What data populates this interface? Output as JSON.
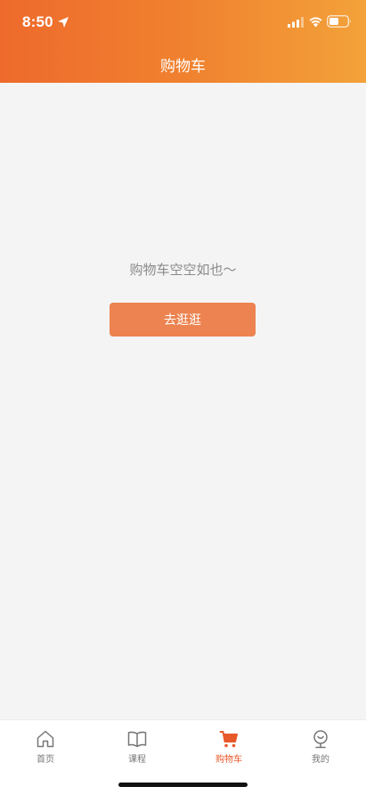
{
  "status_bar": {
    "time": "8:50"
  },
  "nav": {
    "title": "购物车"
  },
  "empty_state": {
    "message": "购物车空空如也～",
    "button_label": "去逛逛"
  },
  "tabbar": {
    "items": [
      {
        "label": "首页",
        "icon": "home-icon",
        "active": false
      },
      {
        "label": "课程",
        "icon": "book-icon",
        "active": false
      },
      {
        "label": "购物车",
        "icon": "cart-icon",
        "active": true
      },
      {
        "label": "我的",
        "icon": "profile-icon",
        "active": false
      }
    ]
  },
  "colors": {
    "header_gradient_start": "#ee6a2c",
    "header_gradient_end": "#f3a23a",
    "button": "#ec8350",
    "active_tab": "#e8592a",
    "inactive_tab": "#777777"
  }
}
